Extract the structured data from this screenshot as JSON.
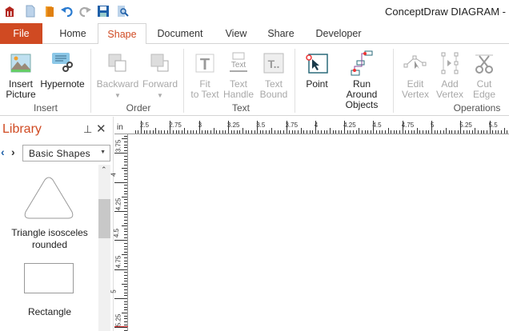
{
  "app_title": "ConceptDraw DIAGRAM -",
  "quick_access": [
    "app-menu-icon",
    "new-document-icon",
    "open-icon",
    "undo-icon",
    "redo-icon",
    "save-icon",
    "print-preview-icon"
  ],
  "tabs": [
    {
      "label": "File"
    },
    {
      "label": "Home"
    },
    {
      "label": "Shape"
    },
    {
      "label": "Document"
    },
    {
      "label": "View"
    },
    {
      "label": "Share"
    },
    {
      "label": "Developer"
    }
  ],
  "ribbon": {
    "buttons": [
      {
        "label": "Insert Picture",
        "enabled": true
      },
      {
        "label": "Hypernote",
        "enabled": true
      },
      {
        "label": "Backward",
        "enabled": false
      },
      {
        "label": "Forward",
        "enabled": false
      },
      {
        "label": "Fit to Text",
        "enabled": false
      },
      {
        "label": "Text Handle",
        "enabled": false
      },
      {
        "label": "Text Bound",
        "enabled": false
      },
      {
        "label": "Point",
        "enabled": true
      },
      {
        "label": "Run Around Objects",
        "enabled": true
      },
      {
        "label": "Edit Vertex",
        "enabled": false
      },
      {
        "label": "Add Vertex",
        "enabled": false
      },
      {
        "label": "Cut Edge",
        "enabled": false
      }
    ],
    "groups": [
      "Insert",
      "Order",
      "Text",
      "Operations"
    ],
    "accent": "#d04a22"
  },
  "library": {
    "title": "Library",
    "selected_library": "Basic Shapes",
    "shapes": [
      {
        "label": "Triangle isosceles rounded"
      },
      {
        "label": "Rectangle"
      }
    ]
  },
  "ruler": {
    "unit": "in",
    "top_labels": [
      "2.5",
      "2.75",
      "3",
      "3.25",
      "3.5",
      "3.75",
      "4",
      "4.25",
      "4.5",
      "4.75",
      "5",
      "5.25",
      "5.5"
    ],
    "left_labels": [
      "3.75",
      "4",
      "4.25",
      "4.5",
      "4.75",
      "5",
      "5.25"
    ]
  }
}
